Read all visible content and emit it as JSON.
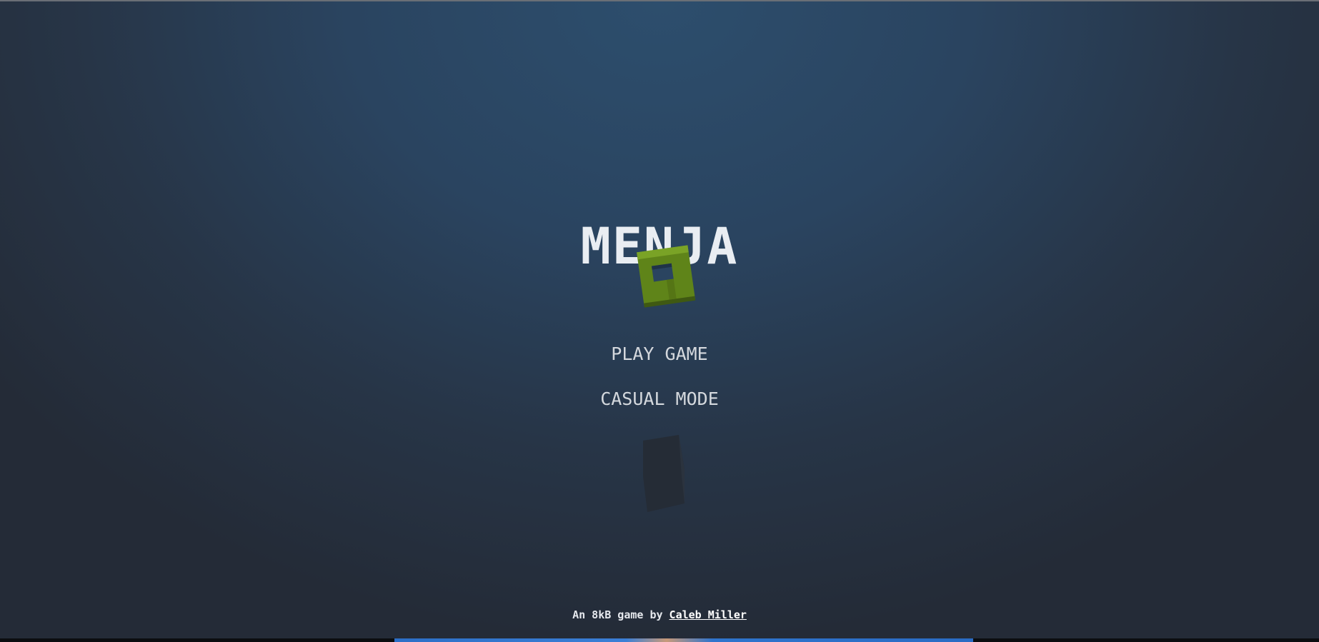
{
  "game": {
    "title": "MENJA",
    "menu": {
      "play_label": "PLAY GAME",
      "casual_label": "CASUAL MODE"
    },
    "footer": {
      "prefix": "An 8kB game by ",
      "author": "Caleb Miller"
    }
  },
  "colors": {
    "background_center": "#2d4e6d",
    "background_edge": "#242b37",
    "title": "#e9edf2",
    "menu_text": "#d4d8dd",
    "green_cube": "#6b8f1e",
    "dark_cube": "#252c36"
  },
  "icons": {
    "green_cube": "green-cube-sprite",
    "dark_cube": "dark-cube-sprite"
  }
}
